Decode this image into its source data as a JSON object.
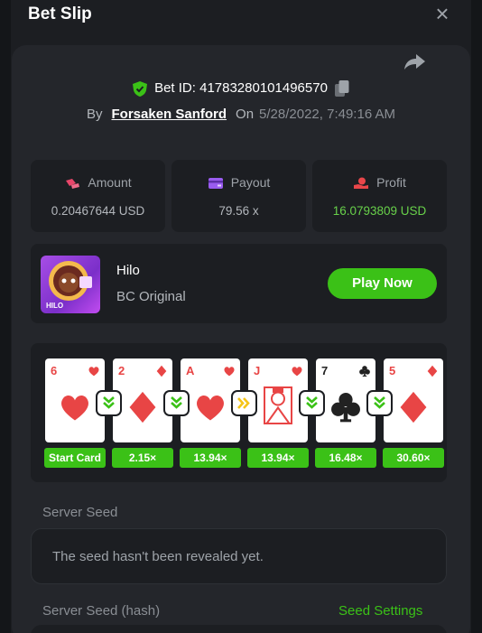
{
  "header": {
    "title": "Bet Slip",
    "close_label": "×"
  },
  "bet": {
    "id_text": "Bet ID: 41783280101496570",
    "by_label": "By",
    "user": "Forsaken Sanford",
    "on_label": "On",
    "date": "5/28/2022, 7:49:16 AM"
  },
  "stats": {
    "amount": {
      "label": "Amount",
      "value": "0.20467644 USD"
    },
    "payout": {
      "label": "Payout",
      "value": "79.56 x"
    },
    "profit": {
      "label": "Profit",
      "value": "16.0793809 USD"
    }
  },
  "game": {
    "name": "Hilo",
    "subtitle": "BC Original",
    "play_label": "Play Now",
    "thumb_text": "HILO"
  },
  "cards": [
    {
      "rank": "6",
      "suit": "hearts",
      "mult": "Start Card"
    },
    {
      "rank": "2",
      "suit": "diamonds",
      "mult": "2.15×"
    },
    {
      "rank": "A",
      "suit": "hearts",
      "mult": "13.94×"
    },
    {
      "rank": "J",
      "suit": "hearts",
      "mult": "13.94×"
    },
    {
      "rank": "7",
      "suit": "clubs",
      "mult": "16.48×"
    },
    {
      "rank": "5",
      "suit": "diamonds",
      "mult": "30.60×"
    }
  ],
  "arrows": [
    "lower",
    "lower",
    "skip",
    "lower",
    "lower"
  ],
  "seed": {
    "server_seed_label": "Server Seed",
    "server_seed_value": "The seed hasn't been revealed yet.",
    "hash_label": "Server Seed (hash)",
    "settings_link": "Seed Settings"
  },
  "colors": {
    "accent": "#3bc117",
    "profit": "#68d14a",
    "card_red": "#e84545",
    "skip": "#f5c518"
  }
}
